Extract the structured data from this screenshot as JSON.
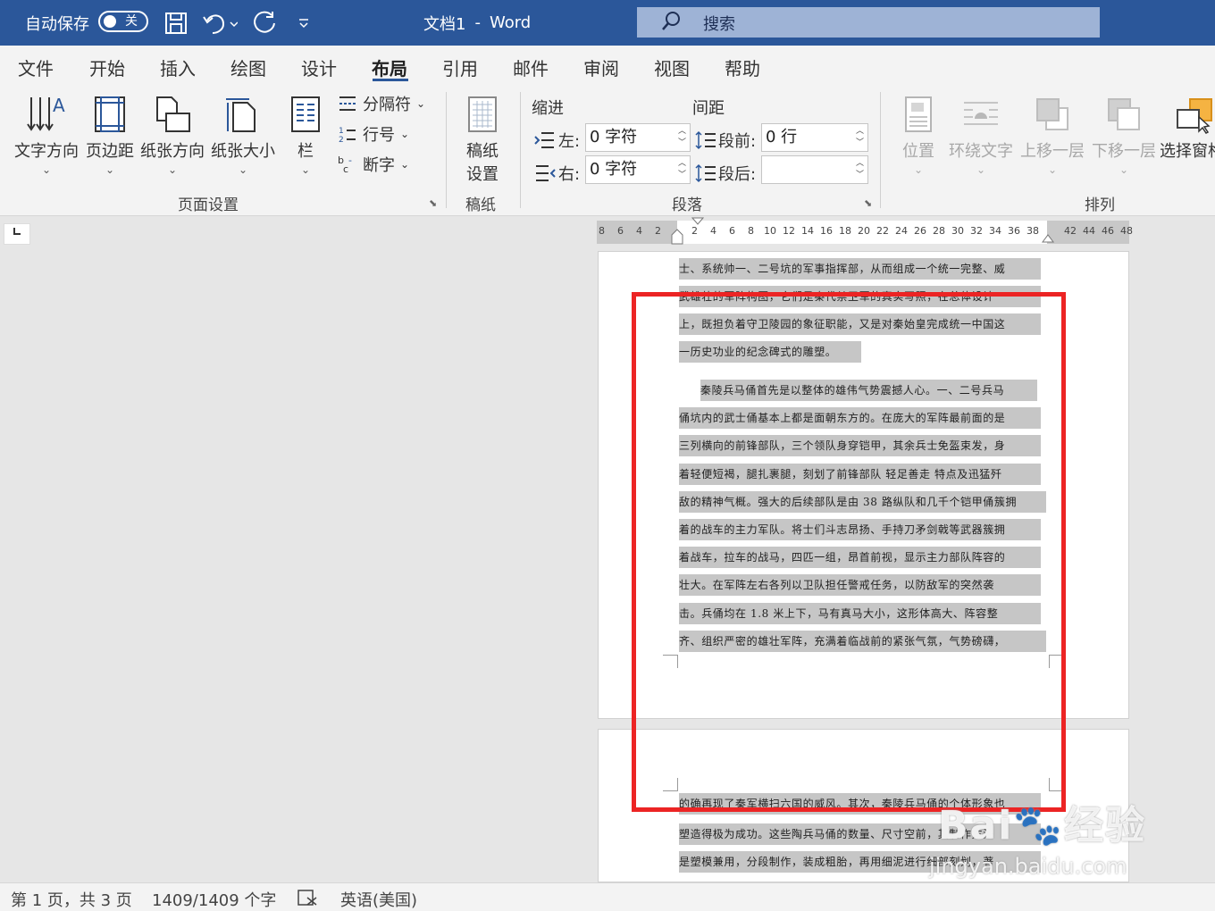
{
  "titlebar": {
    "autosave_label": "自动保存",
    "autosave_state": "关",
    "doc_title": "文档1",
    "separator": "-",
    "app_name": "Word",
    "search_placeholder": "搜索"
  },
  "tabs": [
    "文件",
    "开始",
    "插入",
    "绘图",
    "设计",
    "布局",
    "引用",
    "邮件",
    "审阅",
    "视图",
    "帮助"
  ],
  "active_tab": "布局",
  "ribbon": {
    "page_setup": {
      "text_direction": "文字方向",
      "margins": "页边距",
      "orientation": "纸张方向",
      "size": "纸张大小",
      "columns": "栏",
      "breaks": "分隔符",
      "line_numbers": "行号",
      "hyphenation": "断字",
      "group_label": "页面设置"
    },
    "manuscript": {
      "settings_line1": "稿纸",
      "settings_line2": "设置",
      "group_label": "稿纸"
    },
    "paragraph": {
      "indent_title": "缩进",
      "spacing_title": "间距",
      "left_label": "左:",
      "left_value": "0 字符",
      "right_label": "右:",
      "right_value": "0 字符",
      "before_label": "段前:",
      "before_value": "0 行",
      "after_label": "段后:",
      "after_value": "",
      "group_label": "段落"
    },
    "arrange": {
      "position": "位置",
      "wrap_text": "环绕文字",
      "bring_forward": "上移一层",
      "send_backward": "下移一层",
      "selection_pane": "选择窗格",
      "group_label": "排列"
    }
  },
  "ruler": {
    "labels": [
      "8",
      "6",
      "4",
      "2",
      "2",
      "4",
      "6",
      "8",
      "10",
      "12",
      "14",
      "16",
      "18",
      "20",
      "22",
      "24",
      "26",
      "28",
      "30",
      "32",
      "34",
      "36",
      "38",
      "42",
      "44",
      "46",
      "48"
    ]
  },
  "document": {
    "page1_lines": [
      "士、系统帅一、二号坑的军事指挥部，从而组成一个统一完整、威",
      "武雄壮的军阵构图，它们是秦代禁卫军的真实写照，在总体设计",
      "上，既担负着守卫陵园的象征职能，又是对秦始皇完成统一中国这",
      "一历史功业的纪念碑式的雕塑。",
      "秦陵兵马俑首先是以整体的雄伟气势震撼人心。一、二号兵马",
      "俑坑内的武士俑基本上都是面朝东方的。在庞大的军阵最前面的是",
      "三列横向的前锋部队，三个领队身穿铠甲，其余兵士免盔束发，身",
      "着轻便短褐，腿扎裹腿，刻划了前锋部队 轻足善走 特点及迅猛歼",
      "敌的精神气概。强大的后续部队是由 38 路纵队和几千个铠甲俑簇拥",
      "着的战车的主力军队。将士们斗志昂扬、手持刀矛剑戟等武器簇拥",
      "着战车，拉车的战马，四匹一组，昂首前视，显示主力部队阵容的",
      "壮大。在军阵左右各列以卫队担任警戒任务，以防敌军的突然袭",
      "击。兵俑均在 1.8 米上下，马有真马大小，这形体高大、阵容整",
      "齐、组织严密的雄壮军阵，充满着临战前的紧张气氛，气势磅礴，"
    ],
    "page2_lines": [
      "的确再现了秦军横扫六国的威风。其次，秦陵兵马俑的个体形象也",
      "塑造得极为成功。这些陶兵马俑的数量、尺寸空前，其制作方法",
      "是塑模兼用，分段制作，装成粗胎，再用细泥进行细部刻划，著"
    ]
  },
  "watermark": {
    "brand": "Bai🐾经验",
    "url": "jingyan.baidu.com"
  },
  "statusbar": {
    "page_info": "第 1 页，共 3 页",
    "word_count": "1409/1409 个字",
    "language": "英语(美国)"
  }
}
